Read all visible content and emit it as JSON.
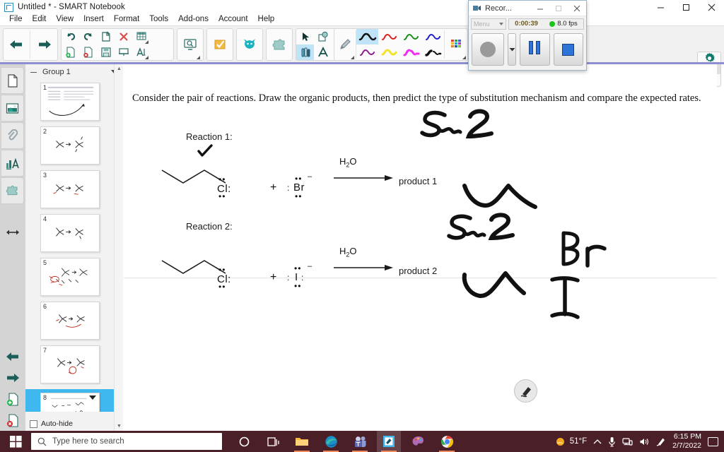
{
  "window": {
    "title": "Untitled * - SMART Notebook",
    "app_icon": "notebook-icon",
    "minimize": "—",
    "maximize": "❐",
    "close": "✕"
  },
  "menubar": {
    "items": [
      "File",
      "Edit",
      "View",
      "Insert",
      "Format",
      "Tools",
      "Add-ons",
      "Account",
      "Help"
    ]
  },
  "toolbar": {
    "groups": [
      {
        "name": "navigation",
        "icons": [
          "back-arrow-icon",
          "forward-arrow-icon"
        ]
      },
      {
        "name": "edit",
        "icons": [
          "undo-icon",
          "redo-icon",
          "new-page-icon",
          "delete-page-icon",
          "add-page-icon",
          "remove-page-icon",
          "save-icon",
          "screen-shade-icon",
          "table-icon",
          "text-icon"
        ]
      },
      {
        "name": "view",
        "icons": [
          "screen-capture-icon"
        ]
      },
      {
        "name": "check",
        "icons": [
          "response-check-icon"
        ]
      },
      {
        "name": "addon",
        "icons": [
          "smart-lab-icon"
        ]
      },
      {
        "name": "puzzle",
        "icons": [
          "puzzle-piece-icon"
        ]
      },
      {
        "name": "tools",
        "icons": [
          "select-arrow-icon",
          "shape-icon",
          "fill-icon",
          "paint-bucket-icon",
          "pens-icon",
          "text-tool-icon",
          "line-icon",
          "eraser-icon"
        ]
      },
      {
        "name": "pens",
        "icons": [
          "pencil-icon",
          "pen-black-icon",
          "pen-red-icon",
          "pen-green-icon",
          "pen-blue-icon",
          "pen-purple-icon",
          "pen-yellow-icon",
          "highlighter-magenta-icon",
          "calligraphy-icon",
          "color-palette-icon"
        ]
      }
    ],
    "selected_tool": "pens-icon",
    "selected_pen": "pen-black-icon"
  },
  "gear_panel": {
    "settings_icon": "gear-icon",
    "resize_icon": "vertical-resize-icon"
  },
  "rail": {
    "tabs": [
      {
        "name": "page-sorter",
        "icon": "page-icon"
      },
      {
        "name": "gallery",
        "icon": "image-icon"
      },
      {
        "name": "attachments",
        "icon": "paperclip-icon"
      },
      {
        "name": "properties",
        "icon": "properties-icon"
      },
      {
        "name": "add-ons",
        "icon": "puzzle-icon"
      }
    ],
    "bottom_icons": [
      "resize-width-icon",
      "back-arrow-icon",
      "forward-arrow-icon",
      "add-page-icon",
      "delete-page-icon"
    ]
  },
  "sidebar": {
    "group_label": "Group 1",
    "collapse_icon": "minus-icon",
    "caret_icon": "chevron-down-icon",
    "autohide_label": "Auto-hide",
    "autohide_checked": false,
    "selected_page": 8,
    "pages": [
      {
        "number": "1",
        "kind": "document"
      },
      {
        "number": "2",
        "kind": "structures"
      },
      {
        "number": "3",
        "kind": "structures"
      },
      {
        "number": "4",
        "kind": "structures"
      },
      {
        "number": "5",
        "kind": "structures-dense"
      },
      {
        "number": "6",
        "kind": "structures-red"
      },
      {
        "number": "7",
        "kind": "structures-red"
      },
      {
        "number": "8",
        "kind": "current"
      }
    ],
    "scroll_up_icon": "chevron-up-icon",
    "scroll_down_icon": "chevron-down-icon"
  },
  "canvas": {
    "prompt": "Consider the pair of reactions. Draw the organic products, then predict the type of substitution mechanism and compare the expected rates.",
    "reactions": [
      {
        "label": "Reaction 1:",
        "substrate": "Cl:",
        "plus": "+",
        "nucleophile": "Br",
        "nucleophile_charge": "–",
        "conditions": "H",
        "conditions_sub": "2",
        "conditions_tail": "O",
        "product_label": "product 1",
        "annotation_mechanism": "Sɴ2",
        "annotation_product": "Br",
        "has_checkmark": true
      },
      {
        "label": "Reaction 2:",
        "substrate": "Cl:",
        "plus": "+",
        "nucleophile": "I",
        "nucleophile_charge": "–",
        "conditions": "H",
        "conditions_sub": "2",
        "conditions_tail": "O",
        "product_label": "product 2",
        "annotation_mechanism": "Sɴ2",
        "annotation_product": "I",
        "has_checkmark": false
      }
    ],
    "floating_pen_icon": "pen-circle-icon"
  },
  "recorder": {
    "title": "Recor...",
    "icon": "recorder-icon",
    "minimize": "—",
    "maximize": "❐",
    "close": "✕",
    "menu_label": "Menu",
    "menu_caret": "chevron-down-icon",
    "timer": "0:00:39",
    "status_color": "#18c518",
    "fps": "8.0 fps",
    "buttons": [
      {
        "name": "record-button",
        "icon": "record-circle-icon"
      },
      {
        "name": "record-options-button",
        "icon": "caret-down-icon"
      },
      {
        "name": "pause-button",
        "icon": "pause-icon"
      },
      {
        "name": "stop-button",
        "icon": "stop-square-icon"
      }
    ]
  },
  "taskbar": {
    "start_icon": "windows-start-icon",
    "search_placeholder": "Type here to search",
    "search_icon": "search-icon",
    "apps": [
      {
        "name": "cortana-icon"
      },
      {
        "name": "task-view-icon"
      },
      {
        "name": "file-explorer-icon"
      },
      {
        "name": "microsoft-edge-icon"
      },
      {
        "name": "teams-icon"
      },
      {
        "name": "smart-notebook-icon"
      },
      {
        "name": "paint-3d-icon"
      },
      {
        "name": "google-chrome-icon"
      }
    ],
    "weather": "51°F",
    "weather_icon": "partly-sunny-icon",
    "tray_icons": [
      "chevron-up-icon",
      "microphone-icon",
      "network-icon",
      "volume-icon",
      "pen-menu-icon"
    ],
    "time": "6:15 PM",
    "date": "2/7/2022",
    "notifications_icon": "notification-icon"
  }
}
